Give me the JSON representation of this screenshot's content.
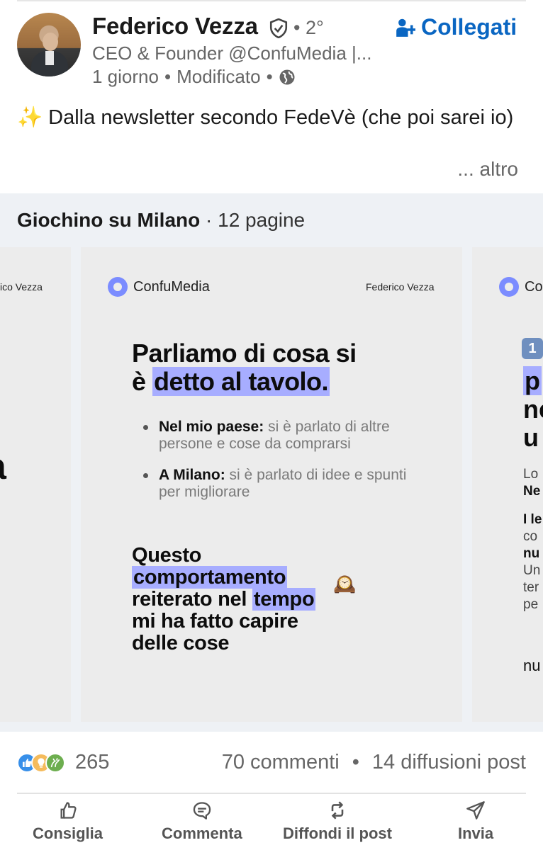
{
  "post": {
    "author": {
      "name": "Federico Vezza",
      "degree": "• 2°",
      "headline": "CEO & Founder @ConfuMedia |...",
      "time": "1 giorno",
      "edited": "Modificato",
      "separator": "•"
    },
    "connect_label": "Collegati",
    "text": "Dalla newsletter secondo FedeVè (che poi sarei io)",
    "sparkle": "✨",
    "more_label": "... altro"
  },
  "document": {
    "title": "Giochino su Milano",
    "pages": "12 pagine",
    "separator": "·",
    "left_slide": {
      "author": "ico Vezza",
      "big1": "a",
      "big2": "."
    },
    "main_slide": {
      "brand": "ConfuMedia",
      "author": "Federico Vezza",
      "title_line1": "Parliamo di cosa si",
      "title_line2_pre": "è ",
      "title_line2_hl": "detto al tavolo.",
      "bullets": [
        {
          "bold": "Nel mio paese:",
          "rest": " si è parlato di altre persone e cose da comprarsi"
        },
        {
          "bold": "A Milano:",
          "rest": " si è parlato di idee e spunti per migliorare"
        }
      ],
      "bottom_line1": "Questo",
      "bottom_line2_hl": "comportamento",
      "bottom_line3_pre": "reiterato nel ",
      "bottom_line3_hl": "tempo",
      "bottom_line4": "mi ha fatto capire",
      "bottom_line5": "delle cose",
      "clock": "🕰️"
    },
    "right_slide": {
      "brand": "Co",
      "badge": "1",
      "t1": "p",
      "t2": "ne",
      "t3": "u",
      "s1": "Lo",
      "s2": "Ne",
      "s3": "I le",
      "s4": "co",
      "s5": "nu",
      "s6": "Un",
      "s7": "ter",
      "s8": "pe",
      "s9": "nu"
    }
  },
  "social": {
    "reactions_count": "265",
    "comments": "70 commenti",
    "dot": "•",
    "reposts": "14 diffusioni post"
  },
  "actions": {
    "like": "Consiglia",
    "comment": "Commenta",
    "repost": "Diffondi il post",
    "send": "Invia"
  },
  "colors": {
    "brand_blue": "#0a66c2",
    "highlight": "#a7adff",
    "doc_bg": "#eef1f5"
  },
  "icons": {
    "verified": "shield-check-icon",
    "connect": "add-person-icon",
    "visibility": "globe-icon",
    "like": "thumbs-up-icon",
    "comment": "comment-icon",
    "repost": "repost-icon",
    "send": "send-icon"
  }
}
